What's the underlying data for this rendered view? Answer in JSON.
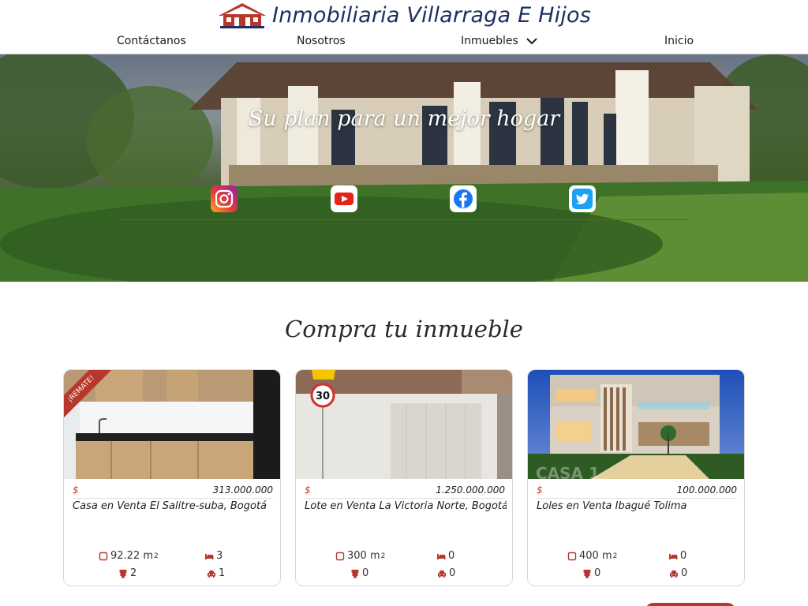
{
  "brand": {
    "name": "Inmobiliaria Villarraga E Hijos",
    "logo_icon": "house-logo-icon"
  },
  "nav": {
    "items": [
      {
        "label": "Contáctanos"
      },
      {
        "label": "Nosotros"
      },
      {
        "label": "Inmuebles",
        "has_dropdown": true
      },
      {
        "label": "Inicio"
      }
    ]
  },
  "hero": {
    "title": "Su plan para un mejor hogar",
    "social": [
      {
        "name": "instagram-icon"
      },
      {
        "name": "youtube-icon"
      },
      {
        "name": "facebook-icon"
      },
      {
        "name": "twitter-icon"
      }
    ]
  },
  "section": {
    "title": "Compra tu inmueble"
  },
  "colors": {
    "accent": "#c1392b",
    "brand": "#1f2f62",
    "ribbon": "#b8372c"
  },
  "cards": [
    {
      "ribbon": "¡REMATE!",
      "currency": "$",
      "price": "313.000.000",
      "title": "Casa en Venta El Salitre-suba, Bogotá",
      "area": "92.22 m",
      "area_unit_sup": "2",
      "bedrooms": "3",
      "bathrooms": "2",
      "parking": "1"
    },
    {
      "currency": "$",
      "price": "1.250.000.000",
      "title": "Lote en Venta La Victoria Norte, Bogotá",
      "area": "300 m",
      "area_unit_sup": "2",
      "bedrooms": "0",
      "bathrooms": "0",
      "parking": "0"
    },
    {
      "currency": "$",
      "price": "100.000.000",
      "title": "Loles en Venta Ibagué Tolima",
      "area": "400 m",
      "area_unit_sup": "2",
      "bedrooms": "0",
      "bathrooms": "0",
      "parking": "0"
    }
  ]
}
